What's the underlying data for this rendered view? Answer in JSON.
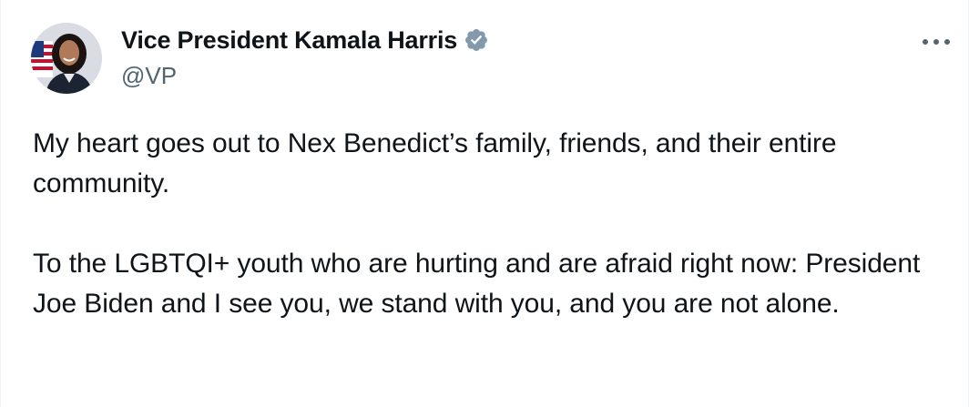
{
  "tweet": {
    "author": {
      "display_name": "Vice President Kamala Harris",
      "handle": "@VP",
      "verified_icon": "verified-badge-icon",
      "verified_color": "#829aab",
      "avatar_icon": "profile-photo"
    },
    "more_icon": "more-horizontal-icon",
    "paragraphs": [
      "My heart goes out to Nex Benedict’s family, friends, and their entire community.",
      "To the LGBTQI+ youth who are hurting and are afraid right now: President Joe Biden and I see you, we stand with you, and you are not alone."
    ]
  },
  "colors": {
    "text": "#0f1419",
    "secondary": "#536471",
    "background": "#ffffff"
  }
}
